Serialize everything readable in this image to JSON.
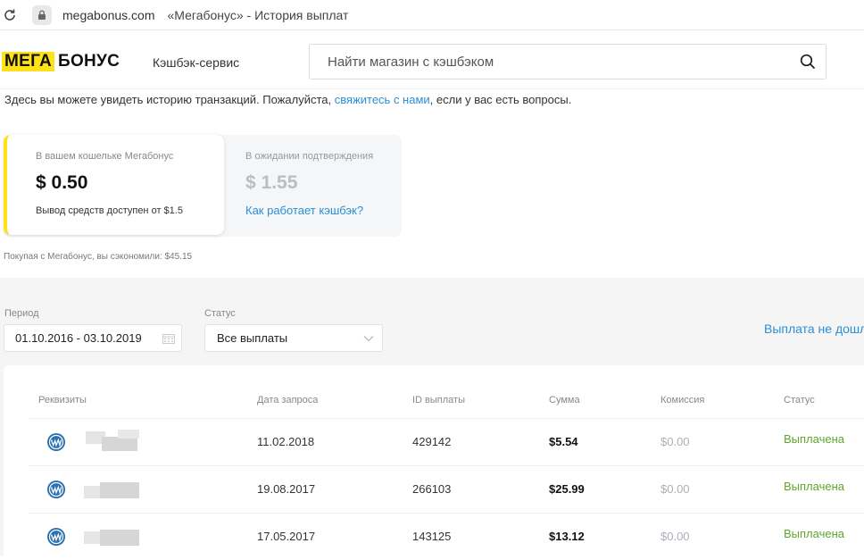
{
  "browser": {
    "domain": "megabonus.com",
    "tab_title": "«Мегабонус» - История выплат",
    "reload_icon": "reload-icon",
    "lock_icon": "lock-icon"
  },
  "header": {
    "logo_part1": "МЕГА",
    "logo_part2": "БОНУС",
    "logo_subtitle": "Кэшбэк-сервис",
    "search_placeholder": "Найти магазин с кэшбэком"
  },
  "intro": {
    "text_before": "Здесь вы можете увидеть историю транзакций. Пожалуйста, ",
    "link_text": "свяжитесь с нами",
    "text_after": ", если у вас есть вопросы."
  },
  "wallet": {
    "label": "В вашем кошельке Мегабонус",
    "amount": "$ 0.50",
    "note": "Вывод средств доступен от $1.5"
  },
  "pending": {
    "label": "В ожидании подтверждения",
    "amount": "$ 1.55",
    "link": "Как работает кэшбэк?"
  },
  "saved_text": "Покупая с Мегабонус, вы сэкономили: $45.15",
  "filters": {
    "period_label": "Период",
    "period_value": "01.10.2016 - 03.10.2019",
    "status_label": "Статус",
    "status_value": "Все выплаты",
    "payout_link": "Выплата не дошл"
  },
  "table": {
    "headers": [
      "Реквизиты",
      "Дата запроса",
      "ID выплаты",
      "Сумма",
      "Комиссия",
      "Статус"
    ],
    "rows": [
      {
        "date": "11.02.2018",
        "id": "429142",
        "amount": "$5.54",
        "fee": "$0.00",
        "status": "Выплачена"
      },
      {
        "date": "19.08.2017",
        "id": "266103",
        "amount": "$25.99",
        "fee": "$0.00",
        "status": "Выплачена"
      },
      {
        "date": "17.05.2017",
        "id": "143125",
        "amount": "$13.12",
        "fee": "$0.00",
        "status": "Выплачена"
      }
    ]
  },
  "colors": {
    "brand_yellow": "#ffe11a",
    "link_blue": "#2c8ed6",
    "status_green": "#5fa62c",
    "webmoney_blue": "#2a6fb0"
  }
}
